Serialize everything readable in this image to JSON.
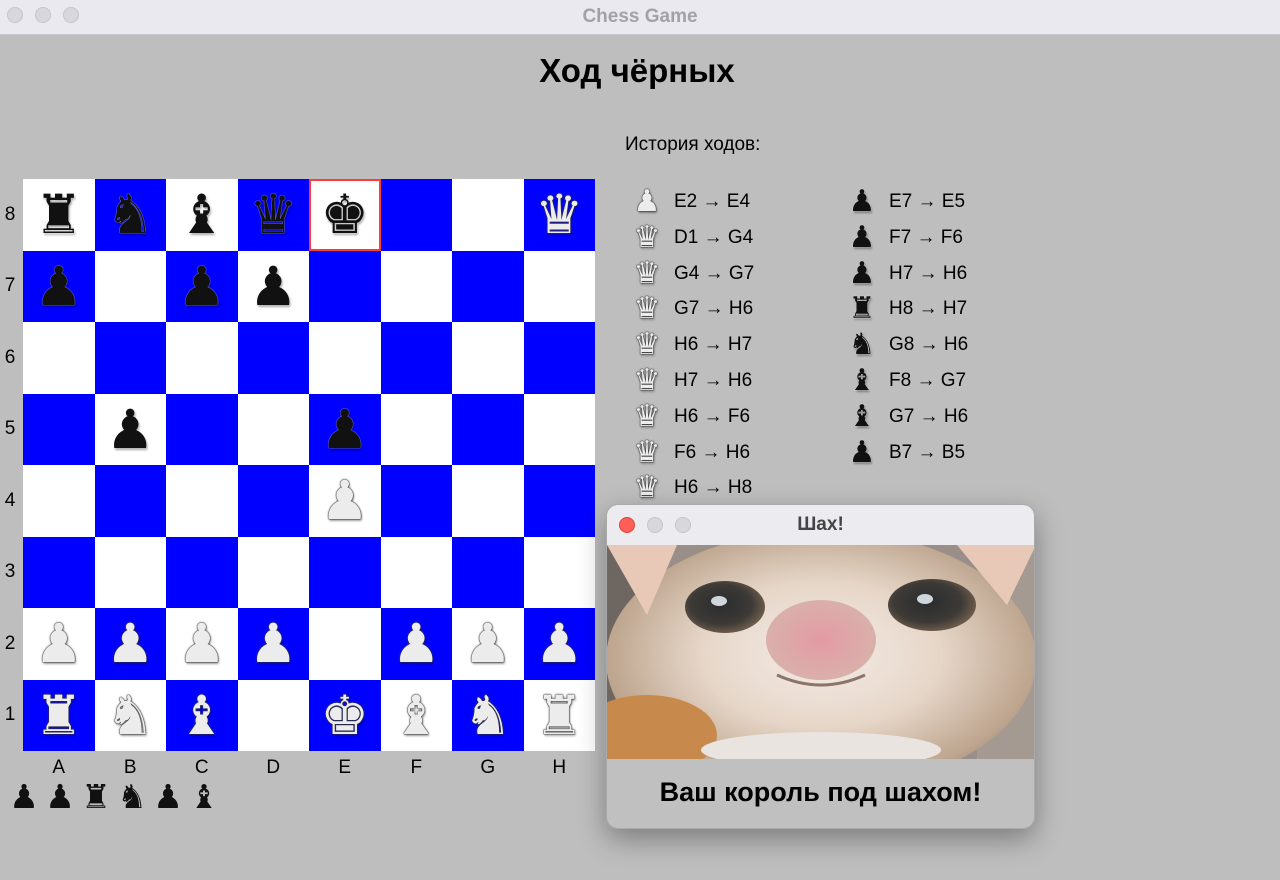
{
  "window": {
    "title": "Chess Game"
  },
  "status": {
    "heading": "Ход чёрных"
  },
  "colors": {
    "light_square": "#ffffff",
    "dark_square": "#0000ff",
    "selected_border": "#ff3b3b",
    "background": "#bebebe"
  },
  "board": {
    "ranks": [
      "8",
      "7",
      "6",
      "5",
      "4",
      "3",
      "2",
      "1"
    ],
    "files": [
      "A",
      "B",
      "C",
      "D",
      "E",
      "F",
      "G",
      "H"
    ],
    "selected_square": "E8",
    "pieces": [
      {
        "square": "A8",
        "color": "black",
        "type": "rook",
        "glyph": "♜"
      },
      {
        "square": "B8",
        "color": "black",
        "type": "knight",
        "glyph": "♞"
      },
      {
        "square": "C8",
        "color": "black",
        "type": "bishop",
        "glyph": "♝"
      },
      {
        "square": "D8",
        "color": "black",
        "type": "queen",
        "glyph": "♛"
      },
      {
        "square": "E8",
        "color": "black",
        "type": "king",
        "glyph": "♚"
      },
      {
        "square": "H8",
        "color": "white",
        "type": "queen",
        "glyph": "♛"
      },
      {
        "square": "A7",
        "color": "black",
        "type": "pawn",
        "glyph": "♟"
      },
      {
        "square": "C7",
        "color": "black",
        "type": "pawn",
        "glyph": "♟"
      },
      {
        "square": "D7",
        "color": "black",
        "type": "pawn",
        "glyph": "♟"
      },
      {
        "square": "B5",
        "color": "black",
        "type": "pawn",
        "glyph": "♟"
      },
      {
        "square": "E5",
        "color": "black",
        "type": "pawn",
        "glyph": "♟"
      },
      {
        "square": "E4",
        "color": "white",
        "type": "pawn",
        "glyph": "♟"
      },
      {
        "square": "A2",
        "color": "white",
        "type": "pawn",
        "glyph": "♟"
      },
      {
        "square": "B2",
        "color": "white",
        "type": "pawn",
        "glyph": "♟"
      },
      {
        "square": "C2",
        "color": "white",
        "type": "pawn",
        "glyph": "♟"
      },
      {
        "square": "D2",
        "color": "white",
        "type": "pawn",
        "glyph": "♟"
      },
      {
        "square": "F2",
        "color": "white",
        "type": "pawn",
        "glyph": "♟"
      },
      {
        "square": "G2",
        "color": "white",
        "type": "pawn",
        "glyph": "♟"
      },
      {
        "square": "H2",
        "color": "white",
        "type": "pawn",
        "glyph": "♟"
      },
      {
        "square": "A1",
        "color": "white",
        "type": "rook",
        "glyph": "♜"
      },
      {
        "square": "B1",
        "color": "white",
        "type": "knight",
        "glyph": "♞"
      },
      {
        "square": "C1",
        "color": "white",
        "type": "bishop",
        "glyph": "♝"
      },
      {
        "square": "E1",
        "color": "white",
        "type": "king",
        "glyph": "♚"
      },
      {
        "square": "F1",
        "color": "white",
        "type": "bishop",
        "glyph": "♝"
      },
      {
        "square": "G1",
        "color": "white",
        "type": "knight",
        "glyph": "♞"
      },
      {
        "square": "H1",
        "color": "white",
        "type": "rook",
        "glyph": "♜"
      }
    ]
  },
  "captured": [
    {
      "type": "pawn",
      "glyph": "♟"
    },
    {
      "type": "pawn",
      "glyph": "♟"
    },
    {
      "type": "rook",
      "glyph": "♜"
    },
    {
      "type": "knight",
      "glyph": "♞"
    },
    {
      "type": "pawn",
      "glyph": "♟"
    },
    {
      "type": "bishop",
      "glyph": "♝"
    }
  ],
  "history": {
    "title": "История ходов:",
    "white": [
      {
        "piece": "pawn",
        "glyph": "♟",
        "move": "E2 → E4"
      },
      {
        "piece": "queen",
        "glyph": "♛",
        "move": "D1 → G4"
      },
      {
        "piece": "queen",
        "glyph": "♛",
        "move": "G4 → G7"
      },
      {
        "piece": "queen",
        "glyph": "♛",
        "move": "G7 → H6"
      },
      {
        "piece": "queen",
        "glyph": "♛",
        "move": "H6 → H7"
      },
      {
        "piece": "queen",
        "glyph": "♛",
        "move": "H7 → H6"
      },
      {
        "piece": "queen",
        "glyph": "♛",
        "move": "H6 → F6"
      },
      {
        "piece": "queen",
        "glyph": "♛",
        "move": "F6 → H6"
      },
      {
        "piece": "queen",
        "glyph": "♛",
        "move": "H6 → H8"
      }
    ],
    "black": [
      {
        "piece": "pawn",
        "glyph": "♟",
        "move": "E7 → E5"
      },
      {
        "piece": "pawn",
        "glyph": "♟",
        "move": "F7 → F6"
      },
      {
        "piece": "pawn",
        "glyph": "♟",
        "move": "H7 → H6"
      },
      {
        "piece": "rook",
        "glyph": "♜",
        "move": "H8 → H7"
      },
      {
        "piece": "knight",
        "glyph": "♞",
        "move": "G8 → H6"
      },
      {
        "piece": "bishop",
        "glyph": "♝",
        "move": "F8 → G7"
      },
      {
        "piece": "bishop",
        "glyph": "♝",
        "move": "G7 → H6"
      },
      {
        "piece": "pawn",
        "glyph": "♟",
        "move": "B7 → B5"
      }
    ]
  },
  "dialog": {
    "title": "Шах!",
    "message": "Ваш король под шахом!",
    "close_color": "#ff5f57"
  }
}
